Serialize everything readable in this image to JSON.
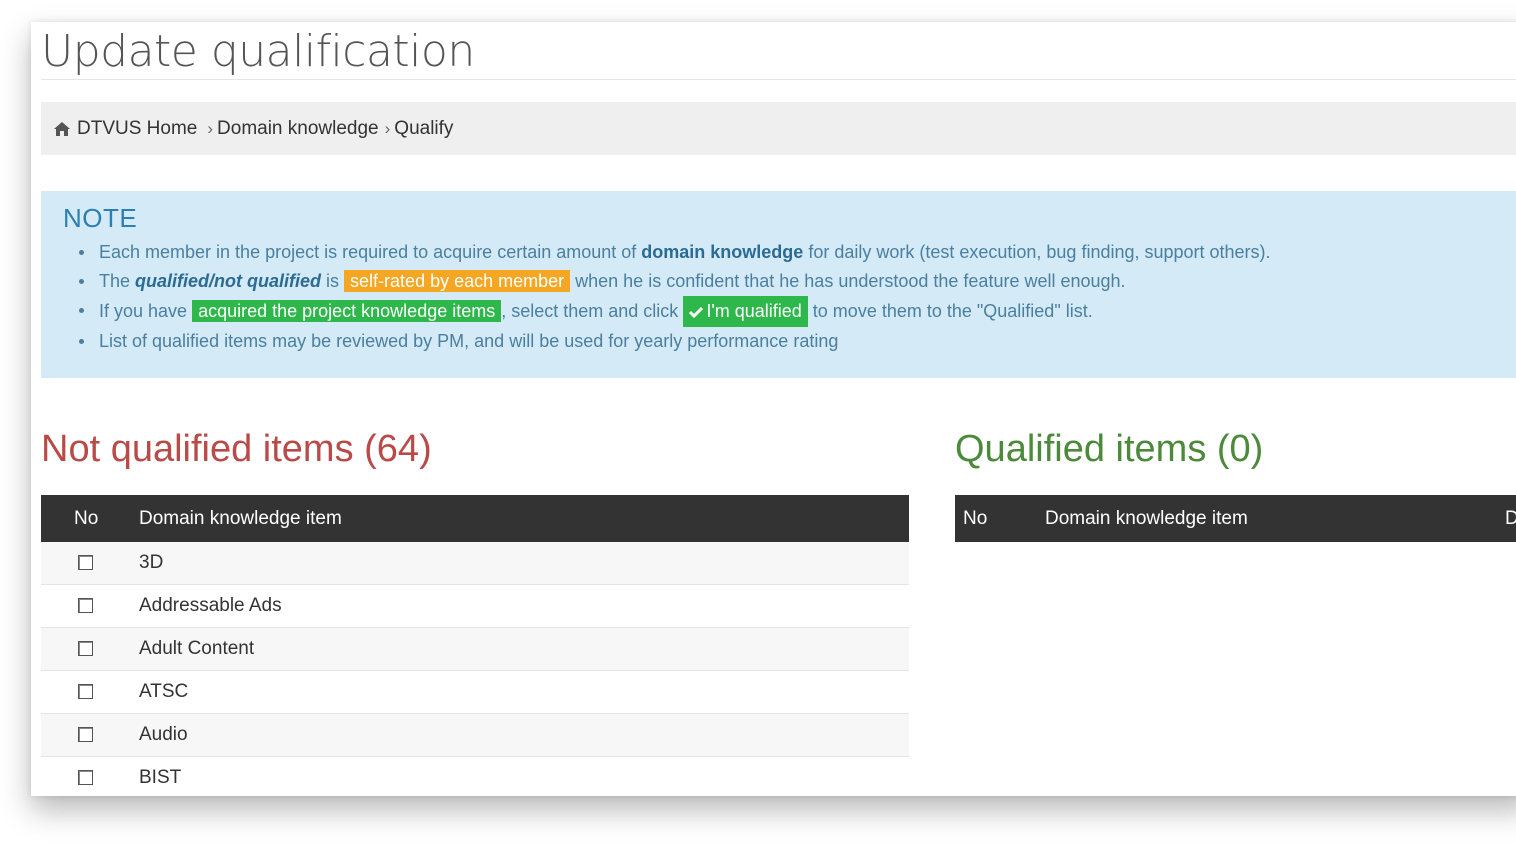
{
  "page": {
    "title": "Update qualification"
  },
  "breadcrumb": {
    "home": "DTVUS Home",
    "sep1": "›",
    "middle": "Domain knowledge",
    "sep2": "›",
    "current": "Qualify"
  },
  "note": {
    "title": "NOTE",
    "line1": {
      "pre": "Each member in the project is required to acquire certain amount of ",
      "bold": "domain knowledge",
      "post": " for daily work (test execution, bug finding, support others)."
    },
    "line2": {
      "pre": "The ",
      "italic": "qualified/not qualified",
      "mid": " is ",
      "label": "self-rated by each member",
      "post": " when he is confident that he has understood the feature well enough."
    },
    "line3": {
      "pre": "If you have ",
      "label": "acquired the project knowledge items",
      "mid": ", select them and click ",
      "button": "I'm qualified",
      "post": " to move them to the \"Qualified\" list."
    },
    "line4": "List of qualified items may be reviewed by PM, and will be used for yearly performance rating"
  },
  "not_qualified": {
    "title": "Not qualified items (64)",
    "headers": {
      "no": "No",
      "item": "Domain knowledge item"
    },
    "rows": [
      "3D",
      "Addressable Ads",
      "Adult Content",
      "ATSC",
      "Audio",
      "BIST"
    ]
  },
  "qualified": {
    "title": "Qualified items (0)",
    "headers": {
      "no": "No",
      "item": "Domain knowledge item",
      "extra": "D"
    }
  },
  "colors": {
    "note_bg": "#d4eaf6",
    "not_qualified_title": "#b94a48",
    "qualified_title": "#4b8a3a",
    "table_header": "#333333",
    "label_orange": "#f5a623",
    "label_green": "#2eb84b"
  }
}
